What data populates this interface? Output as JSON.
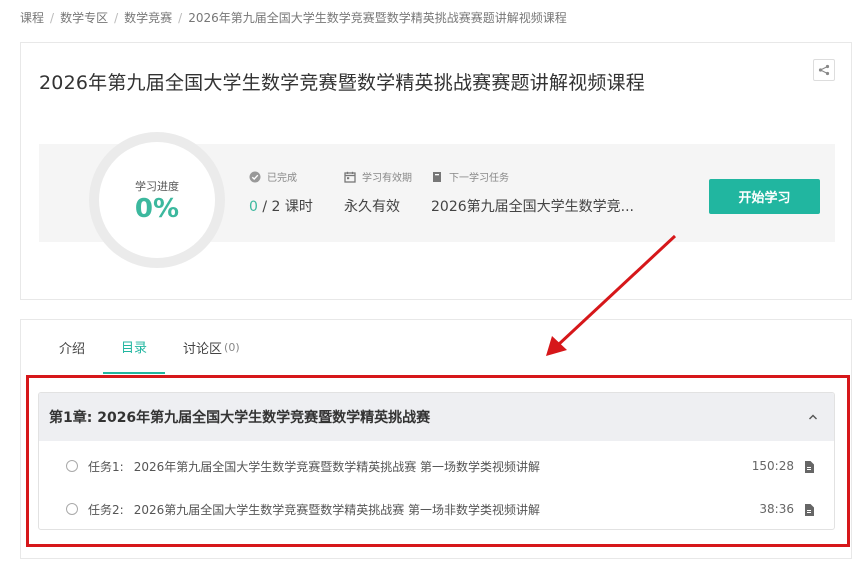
{
  "breadcrumb": {
    "items": [
      "课程",
      "数学专区",
      "数学竞赛",
      "2026年第九届全国大学生数学竞赛暨数学精英挑战赛赛题讲解视频课程"
    ],
    "separator": "/"
  },
  "course": {
    "title": "2026年第九届全国大学生数学竞赛暨数学精英挑战赛赛题讲解视频课程",
    "share_icon": "share-icon"
  },
  "progress": {
    "label": "学习进度",
    "value": "0%",
    "fraction": 0
  },
  "stats": {
    "completed": {
      "label": "已完成",
      "done": "0",
      "total": " / 2 课时",
      "icon": "check-circle-icon"
    },
    "validity": {
      "label": "学习有效期",
      "value": "永久有效",
      "icon": "calendar-icon"
    },
    "next_task": {
      "label": "下一学习任务",
      "value": "2026第九届全国大学生数学竞...",
      "icon": "book-icon"
    }
  },
  "start_button": "开始学习",
  "tabs": [
    {
      "label": "介绍",
      "count": ""
    },
    {
      "label": "目录",
      "count": ""
    },
    {
      "label": "讨论区",
      "count": "(0)"
    }
  ],
  "chapter": {
    "title": "第1章: 2026年第九届全国大学生数学竞赛暨数学精英挑战赛",
    "tasks": [
      {
        "label": "任务1:",
        "name": "2026年第九届全国大学生数学竞赛暨数学精英挑战赛 第一场数学类视频讲解",
        "duration": "150:28"
      },
      {
        "label": "任务2:",
        "name": "2026第九届全国大学生数学竞赛暨数学精英挑战赛 第一场非数学类视频讲解",
        "duration": "38:36"
      }
    ]
  },
  "colors": {
    "accent": "#21b6a0",
    "progress_text": "#3cb89e",
    "annotation": "#d6171a"
  }
}
